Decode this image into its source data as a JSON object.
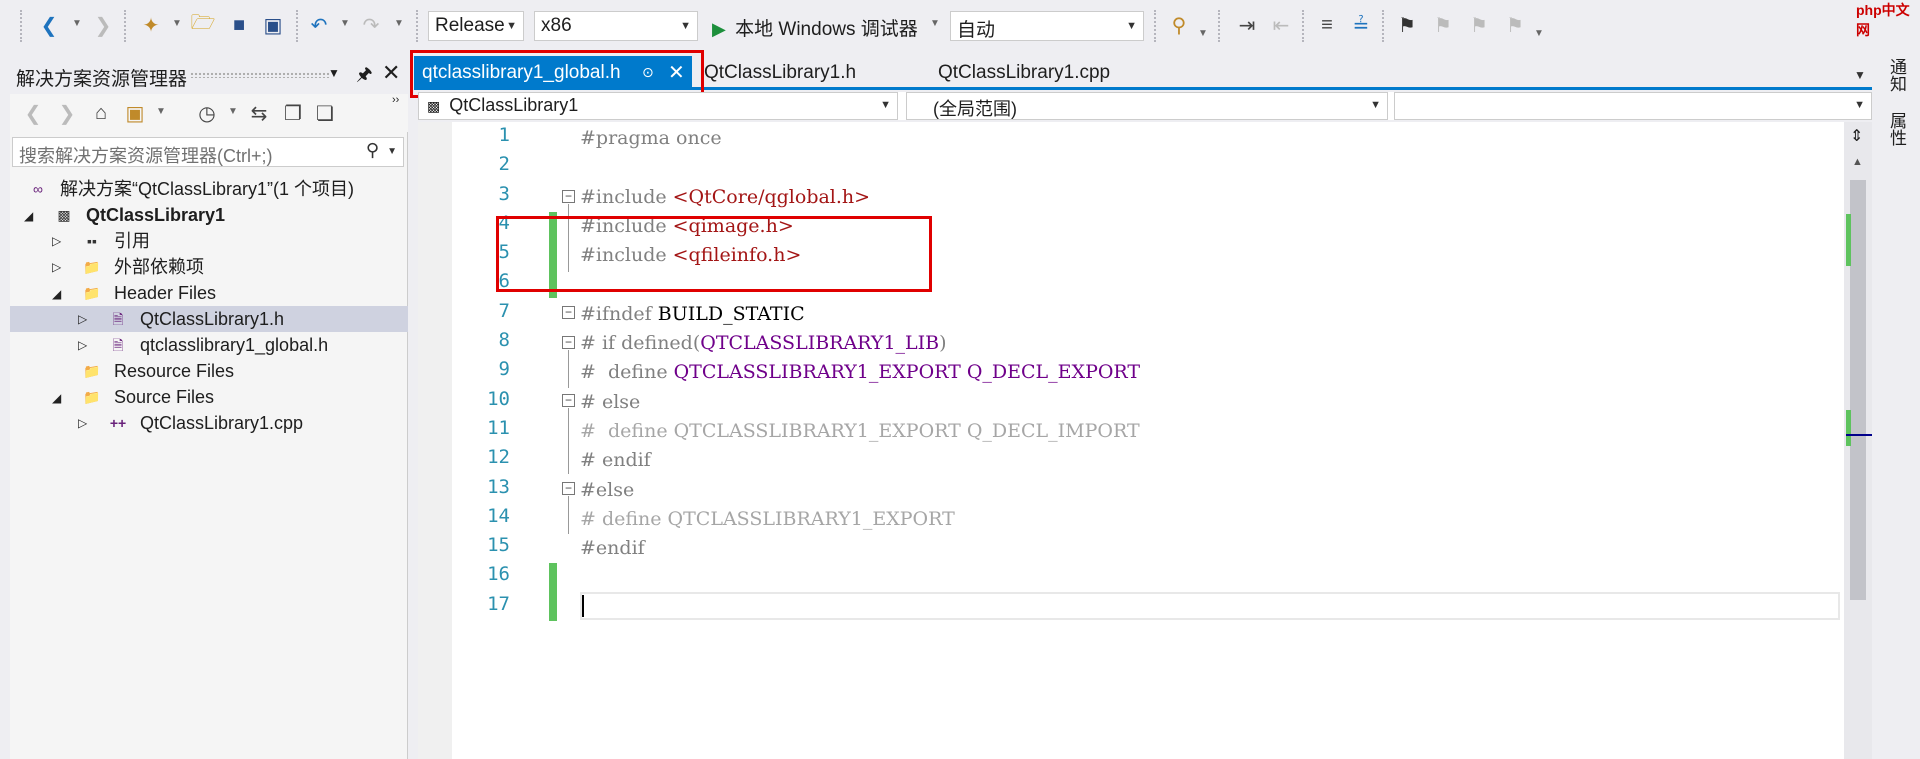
{
  "toolbar": {
    "config_value": "Release",
    "platform_value": "x86",
    "debugger_label": "本地 Windows 调试器",
    "auto_value": "自动"
  },
  "solution_explorer": {
    "title": "解决方案资源管理器",
    "search_placeholder": "搜索解决方案资源管理器(Ctrl+;)",
    "tree": [
      {
        "label": "解决方案“QtClassLibrary1”(1 个项目)"
      },
      {
        "label": "QtClassLibrary1"
      },
      {
        "label": "引用"
      },
      {
        "label": "外部依赖项"
      },
      {
        "label": "Header Files"
      },
      {
        "label": "QtClassLibrary1.h"
      },
      {
        "label": "qtclasslibrary1_global.h"
      },
      {
        "label": "Resource Files"
      },
      {
        "label": "Source Files"
      },
      {
        "label": "QtClassLibrary1.cpp"
      }
    ]
  },
  "tabs": [
    {
      "label": "qtclasslibrary1_global.h"
    },
    {
      "label": "QtClassLibrary1.h"
    },
    {
      "label": "QtClassLibrary1.cpp"
    }
  ],
  "navbar": {
    "project": "QtClassLibrary1",
    "scope": "(全局范围)"
  },
  "editor": {
    "line_numbers": [
      "1",
      "2",
      "3",
      "4",
      "5",
      "6",
      "7",
      "8",
      "9",
      "10",
      "11",
      "12",
      "13",
      "14",
      "15",
      "16",
      "17"
    ],
    "lines": {
      "l1": "#pragma once",
      "l3a": "#include ",
      "l3b": "<QtCore/qglobal.h>",
      "l4a": "#include ",
      "l4b": "<qimage.h>",
      "l5a": "#include ",
      "l5b": "<qfileinfo.h>",
      "l7a": "#ifndef ",
      "l7b": "BUILD_STATIC",
      "l8a": "# if defined(",
      "l8b": "QTCLASSLIBRARY1_LIB",
      "l8c": ")",
      "l9a": "#  define ",
      "l9b": "QTCLASSLIBRARY1_EXPORT Q_DECL_EXPORT",
      "l10": "# else",
      "l11": "#  define QTCLASSLIBRARY1_EXPORT Q_DECL_IMPORT",
      "l12": "# endif",
      "l13": "#else",
      "l14": "# define QTCLASSLIBRARY1_EXPORT",
      "l15": "#endif"
    }
  },
  "right_panel": {
    "notifications": "通知",
    "properties": "属性"
  },
  "watermark": "php中文网",
  "colors": {
    "accent": "#007acc",
    "highlight_red": "#e00000",
    "change_green": "#5ec35e"
  }
}
